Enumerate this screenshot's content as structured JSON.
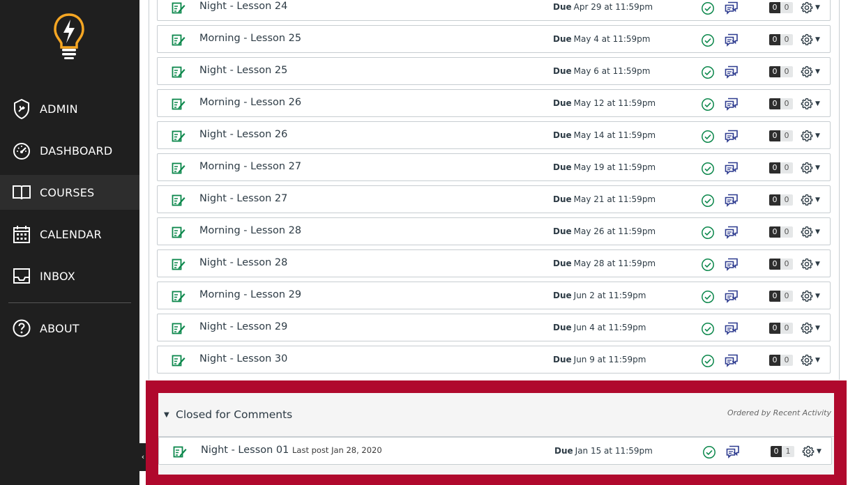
{
  "sidebar": {
    "items": [
      {
        "label": "ADMIN",
        "icon": "admin-shield-icon"
      },
      {
        "label": "DASHBOARD",
        "icon": "dashboard-gauge-icon"
      },
      {
        "label": "COURSES",
        "icon": "courses-book-icon",
        "active": true
      },
      {
        "label": "CALENDAR",
        "icon": "calendar-icon"
      },
      {
        "label": "INBOX",
        "icon": "inbox-icon"
      },
      {
        "label": "ABOUT",
        "icon": "help-circle-icon"
      }
    ],
    "collapse_glyph": "‹"
  },
  "discussions": [
    {
      "title": "Night - Lesson 24",
      "due_label": "Due",
      "due": "Apr 29 at 11:59pm",
      "unread": "0",
      "replies": "0"
    },
    {
      "title": "Morning - Lesson 25",
      "due_label": "Due",
      "due": "May 4 at 11:59pm",
      "unread": "0",
      "replies": "0"
    },
    {
      "title": "Night - Lesson 25",
      "due_label": "Due",
      "due": "May 6 at 11:59pm",
      "unread": "0",
      "replies": "0"
    },
    {
      "title": "Morning - Lesson 26",
      "due_label": "Due",
      "due": "May 12 at 11:59pm",
      "unread": "0",
      "replies": "0"
    },
    {
      "title": "Night - Lesson 26",
      "due_label": "Due",
      "due": "May 14 at 11:59pm",
      "unread": "0",
      "replies": "0"
    },
    {
      "title": "Morning - Lesson 27",
      "due_label": "Due",
      "due": "May 19 at 11:59pm",
      "unread": "0",
      "replies": "0"
    },
    {
      "title": "Night - Lesson 27",
      "due_label": "Due",
      "due": "May 21 at 11:59pm",
      "unread": "0",
      "replies": "0"
    },
    {
      "title": "Morning - Lesson 28",
      "due_label": "Due",
      "due": "May 26 at 11:59pm",
      "unread": "0",
      "replies": "0"
    },
    {
      "title": "Night - Lesson 28",
      "due_label": "Due",
      "due": "May 28 at 11:59pm",
      "unread": "0",
      "replies": "0"
    },
    {
      "title": "Morning - Lesson 29",
      "due_label": "Due",
      "due": "Jun 2 at 11:59pm",
      "unread": "0",
      "replies": "0"
    },
    {
      "title": "Night - Lesson 29",
      "due_label": "Due",
      "due": "Jun 4 at 11:59pm",
      "unread": "0",
      "replies": "0"
    },
    {
      "title": "Night - Lesson 30",
      "due_label": "Due",
      "due": "Jun 9 at 11:59pm",
      "unread": "0",
      "replies": "0"
    }
  ],
  "closed_section": {
    "title": "Closed for Comments",
    "order_label": "Ordered by Recent Activity",
    "items": [
      {
        "title": "Night - Lesson 01",
        "last_post": "Last post Jan 28, 2020",
        "due_label": "Due",
        "due": "Jan 15 at 11:59pm",
        "unread": "0",
        "replies": "1"
      }
    ]
  },
  "colors": {
    "sidebar_bg": "#1f1f1f",
    "accent_red": "#b0092d",
    "success_green": "#0b874b",
    "discussion_blue": "#2d3b8f"
  }
}
